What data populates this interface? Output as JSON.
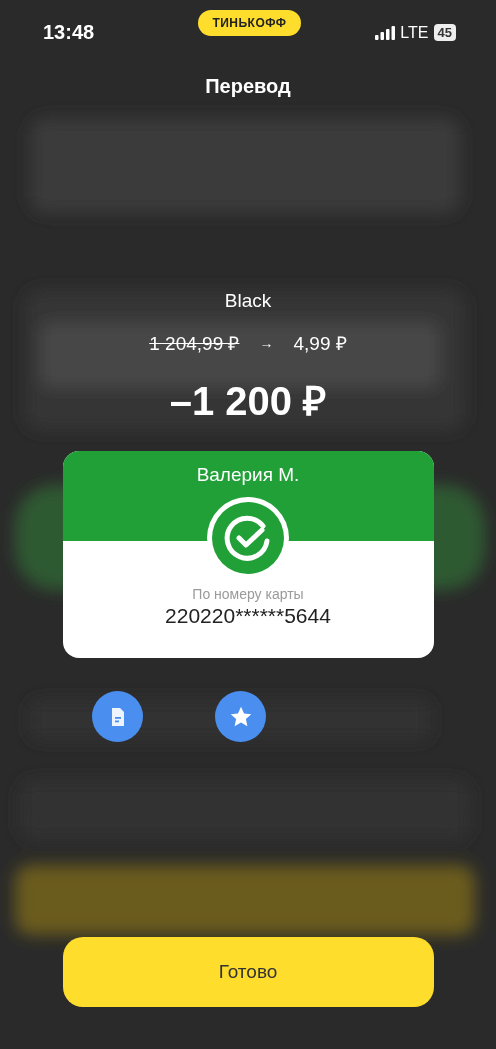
{
  "status_bar": {
    "time": "13:48",
    "badge": "ТИНЬКОФФ",
    "network": "LTE",
    "battery": "45"
  },
  "title": "Перевод",
  "account": {
    "name": "Black",
    "old_balance": "1 204,99 ₽",
    "arrow": "→",
    "new_balance": "4,99 ₽"
  },
  "amount": "–1 200 ₽",
  "recipient": {
    "name": "Валерия М.",
    "method": "По номеру карты",
    "card": "220220******5644"
  },
  "actions": [
    {
      "kind": "receipt"
    },
    {
      "kind": "favorite"
    }
  ],
  "done_button": "Готово"
}
